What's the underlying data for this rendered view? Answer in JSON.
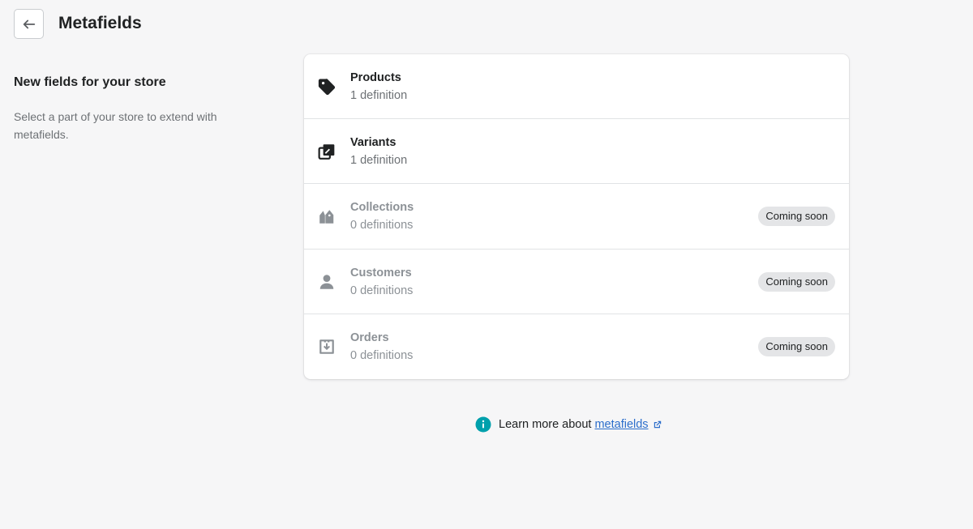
{
  "header": {
    "title": "Metafields",
    "back_icon": "arrow-left-icon"
  },
  "intro": {
    "heading": "New fields for your store",
    "description": "Select a part of your store to extend with metafields."
  },
  "rows": [
    {
      "title": "Products",
      "subtitle": "1 definition",
      "icon": "tag-icon",
      "badge": ""
    },
    {
      "title": "Variants",
      "subtitle": "1 definition",
      "icon": "variants-icon",
      "badge": ""
    },
    {
      "title": "Collections",
      "subtitle": "0 definitions",
      "icon": "collections-icon",
      "badge": "Coming soon"
    },
    {
      "title": "Customers",
      "subtitle": "0 definitions",
      "icon": "customer-icon",
      "badge": "Coming soon"
    },
    {
      "title": "Orders",
      "subtitle": "0 definitions",
      "icon": "order-icon",
      "badge": "Coming soon"
    }
  ],
  "footer": {
    "text": "Learn more about",
    "link": "metafields",
    "info_icon": "info-icon",
    "link_icon": "external-link-icon"
  },
  "colors": {
    "background": "#f6f6f7",
    "link": "#2c6ecb",
    "info": "#00a0ac",
    "badge_bg": "#e4e5e7"
  }
}
